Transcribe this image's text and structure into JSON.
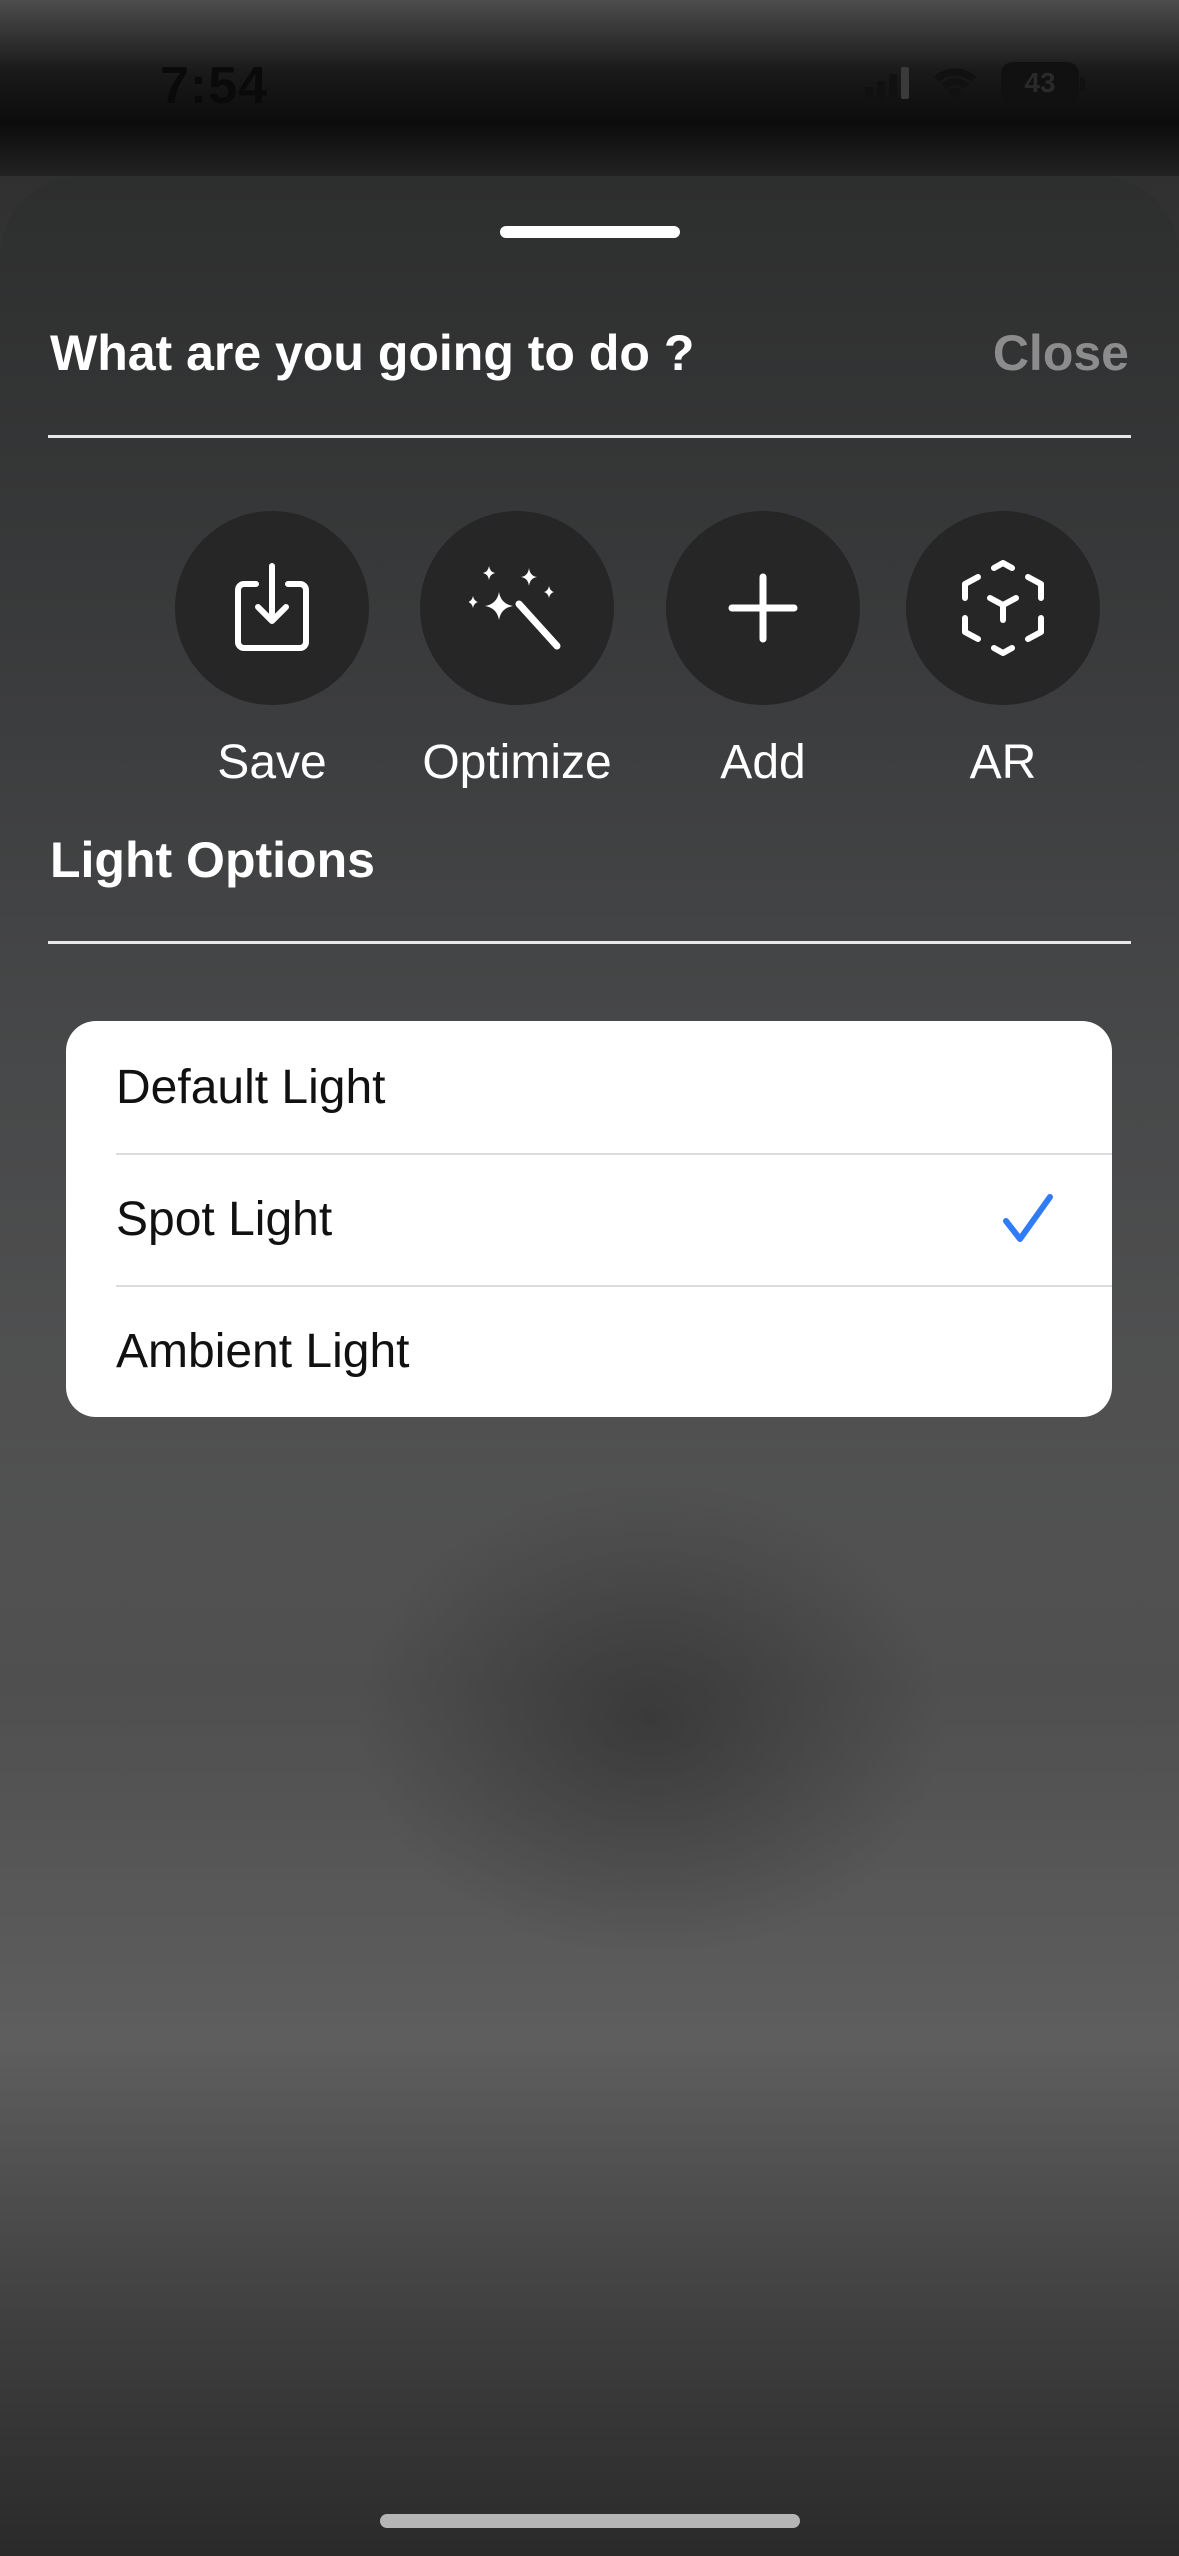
{
  "status_bar": {
    "time": "7:54",
    "battery": "43",
    "icons": [
      "signal-icon",
      "wifi-icon",
      "battery-icon"
    ]
  },
  "sheet": {
    "title": "What are you going to do ?",
    "close_label": "Close",
    "actions": [
      {
        "label": "Save",
        "icon": "save-icon"
      },
      {
        "label": "Optimize",
        "icon": "magic-wand-icon"
      },
      {
        "label": "Add",
        "icon": "plus-icon"
      },
      {
        "label": "AR",
        "icon": "ar-cube-icon"
      }
    ],
    "section_title": "Light Options",
    "light_options": [
      {
        "label": "Default Light",
        "selected": false
      },
      {
        "label": "Spot Light",
        "selected": true
      },
      {
        "label": "Ambient Light",
        "selected": false
      }
    ]
  },
  "colors": {
    "check_accent": "#2f7cf6",
    "close_text": "#8c8c8c",
    "action_circle": "#262626"
  }
}
